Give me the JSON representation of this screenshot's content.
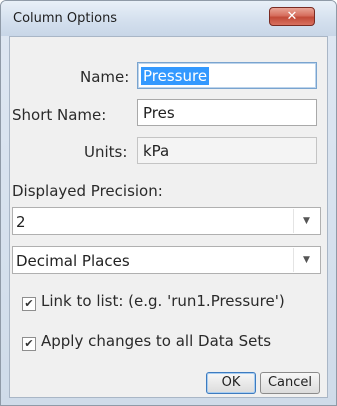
{
  "window": {
    "title": "Column Options",
    "close_glyph": "✕"
  },
  "form": {
    "name_label": "Name:",
    "name_value": "Pressure",
    "short_name_label": "Short Name:",
    "short_name_value": "Pres",
    "units_label": "Units:",
    "units_value": "kPa",
    "precision_label": "Displayed Precision:",
    "precision_value": "2",
    "precision_mode": "Decimal Places"
  },
  "options": {
    "link_label": "Link to list: (e.g. 'run1.Pressure')",
    "link_checked": true,
    "apply_label": "Apply changes to all Data Sets",
    "apply_checked": true
  },
  "buttons": {
    "ok": "OK",
    "cancel": "Cancel"
  },
  "icons": {
    "dropdown": "chevron-down-icon",
    "check": "checkmark-icon"
  }
}
